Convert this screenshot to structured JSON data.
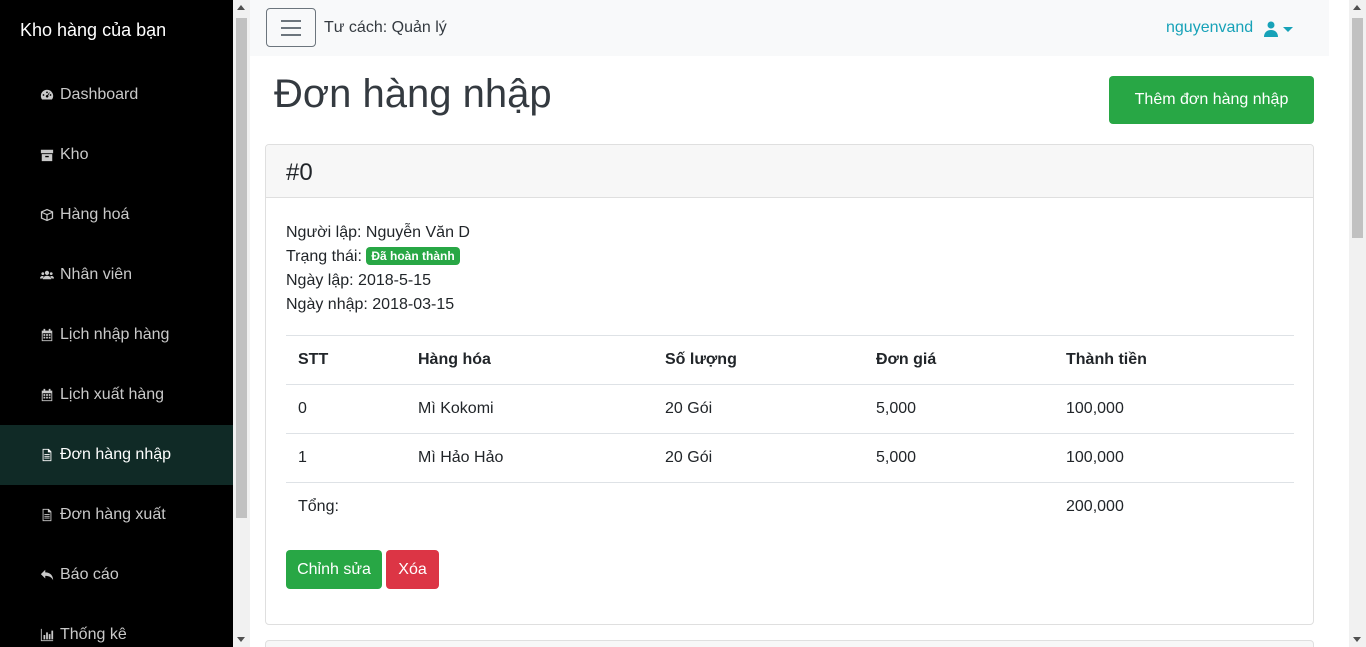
{
  "sidebar": {
    "brand": "Kho hàng của bạn",
    "items": [
      {
        "label": "Dashboard",
        "icon": "dashboard-icon"
      },
      {
        "label": "Kho",
        "icon": "archive-icon"
      },
      {
        "label": "Hàng hoá",
        "icon": "cube-icon"
      },
      {
        "label": "Nhân viên",
        "icon": "users-icon"
      },
      {
        "label": "Lịch nhập hàng",
        "icon": "calendar-icon"
      },
      {
        "label": "Lịch xuất hàng",
        "icon": "calendar-icon"
      },
      {
        "label": "Đơn hàng nhập",
        "icon": "file-icon",
        "active": true
      },
      {
        "label": "Đơn hàng xuất",
        "icon": "file-icon"
      },
      {
        "label": "Báo cáo",
        "icon": "reply-icon"
      },
      {
        "label": "Thống kê",
        "icon": "bar-chart-icon"
      }
    ]
  },
  "topbar": {
    "role": "Tư cách: Quản lý",
    "username": "nguyenvand"
  },
  "page": {
    "title": "Đơn hàng nhập",
    "add_button": "Thêm đơn hàng nhập"
  },
  "order": {
    "id": "#0",
    "creator_label": "Người lập: Nguyễn Văn D",
    "status_label": "Trạng thái:",
    "status_badge": "Đã hoàn thành",
    "created_label": "Ngày lập: 2018-5-15",
    "imported_label": "Ngày nhập: 2018-03-15",
    "table": {
      "headers": [
        "STT",
        "Hàng hóa",
        "Số lượng",
        "Đơn giá",
        "Thành tiền"
      ],
      "rows": [
        [
          "0",
          "Mì Kokomi",
          "20 Gói",
          "5,000",
          "100,000"
        ],
        [
          "1",
          "Mì Hảo Hảo",
          "20 Gói",
          "5,000",
          "100,000"
        ]
      ],
      "total_label": "Tổng:",
      "total_value": "200,000"
    },
    "edit_button": "Chỉnh sửa",
    "delete_button": "Xóa"
  },
  "colors": {
    "sidebar_bg": "#000000",
    "sidebar_active": "#102a26",
    "success": "#28a745",
    "danger": "#dc3545",
    "info": "#17a2b8"
  }
}
